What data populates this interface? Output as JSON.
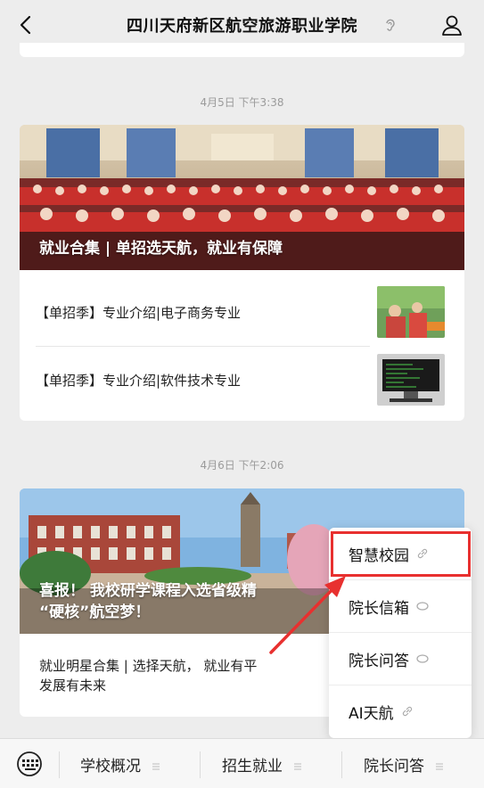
{
  "header": {
    "title": "四川天府新区航空旅游职业学院"
  },
  "sections": [
    {
      "time": "4月5日 下午3:38",
      "hero_caption": "就业合集 | 单招选天航，就业有保障",
      "items": [
        {
          "title": "【单招季】专业介绍|电子商务专业"
        },
        {
          "title": "【单招季】专业介绍|软件技术专业"
        }
      ]
    },
    {
      "time": "4月6日 下午2:06",
      "hero_caption": "喜报！ 我校研学课程入选省级精品\n“硬核”航空梦！",
      "hero_line1": "喜报！ 我校研学课程入选省级精",
      "hero_line2": "“硬核”航空梦！",
      "text_line1": "就业明星合集 | 选择天航， 就业有平",
      "text_line2": "发展有未来"
    }
  ],
  "popup": {
    "items": [
      {
        "label": "智慧校园",
        "icon": "link-icon"
      },
      {
        "label": "院长信箱",
        "icon": "chat-icon"
      },
      {
        "label": "院长问答",
        "icon": "chat-icon"
      },
      {
        "label": "AI天航",
        "icon": "link-icon"
      }
    ],
    "highlight_color": "#e8302f"
  },
  "bottom_menu": {
    "tabs": [
      {
        "label": "学校概况"
      },
      {
        "label": "招生就业"
      },
      {
        "label": "院长问答"
      }
    ]
  }
}
